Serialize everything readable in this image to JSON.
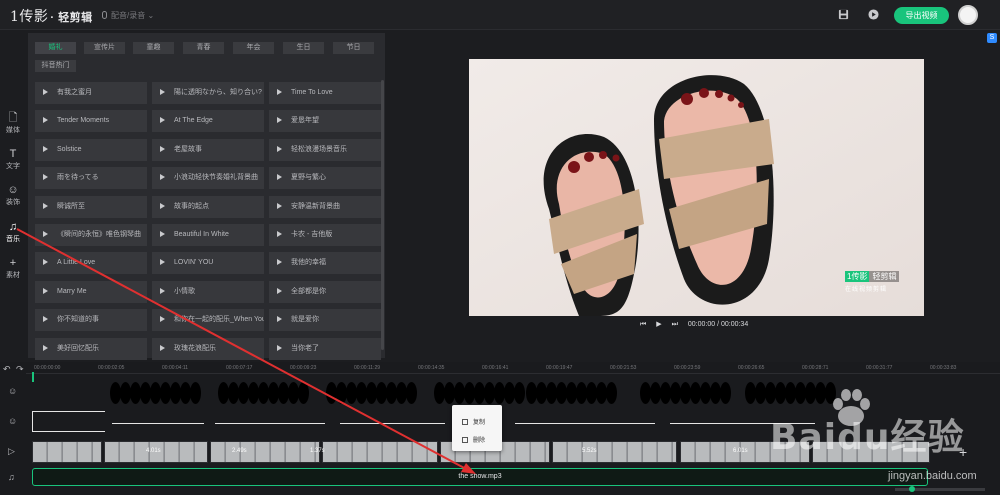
{
  "app": {
    "logo_main": "1传影",
    "logo_sub": "· 轻剪辑",
    "voice_label": "配音/录音 ⌄",
    "export_label": "导出视频"
  },
  "nav": [
    {
      "label": "媒体",
      "icon": "file-icon"
    },
    {
      "label": "文字",
      "icon": "text-icon"
    },
    {
      "label": "装饰",
      "icon": "smile-icon"
    },
    {
      "label": "音乐",
      "icon": "music-icon"
    },
    {
      "label": "素材",
      "icon": "plus-icon"
    }
  ],
  "tabs": [
    "婚礼",
    "宣传片",
    "童趣",
    "青春",
    "年会",
    "生日",
    "节日",
    "抖音热门"
  ],
  "music": [
    "有我之蜜月",
    "陽に透明なから、知り合い?",
    "Time To Love",
    "Tender Moments",
    "At The Edge",
    "爱恳年望",
    "Solstice",
    "老屋故事",
    "轻松浪漫场景音乐",
    "雨を待ってる",
    "小浪动轻快节奏婚礼背景曲",
    "夏野与繁心",
    "瞬诚所至",
    "故事的起点",
    "安静温新背景曲",
    "《瞬间的永恒》唯色钢琴曲",
    "Beautiful In White",
    "卡农 - 吉他版",
    "A Little Love",
    "LOVIN' YOU",
    "我他的幸福",
    "Marry Me",
    "小情歌",
    "全部都是你",
    "你不知道的事",
    "和你在一起的配乐_When You Say...",
    "就是爱你",
    "美好回忆配乐",
    "玫瑰花浪配乐",
    "当你老了"
  ],
  "preview": {
    "watermark_brand": "1传影",
    "watermark_title": "轻剪辑",
    "watermark_sub": "在线视频剪辑",
    "time": "00:00:00 / 00:00:34"
  },
  "timeline": {
    "ticks": [
      "00:00:00:00",
      "00:00:02:05",
      "00:00:04:11",
      "00:00:07:17",
      "00:00:09:23",
      "00:00:11:29",
      "00:00:14:35",
      "00:00:16:41",
      "00:00:19:47",
      "00:00:21:53",
      "00:00:23:59",
      "00:00:26:65",
      "00:00:28:71",
      "00:00:31:77",
      "00:00:33:83"
    ],
    "clip_durations": [
      "4.01s",
      "2.49s",
      "1.37s",
      "5.52s",
      "6.01s"
    ],
    "audio_name": "the show.mp3",
    "context_menu": [
      "复制",
      "删除"
    ]
  },
  "watermark": {
    "text": "Baidu经验",
    "url": "jingyan.baidu.com"
  },
  "colors": {
    "accent": "#19c47c",
    "annotation": "#e03030"
  }
}
